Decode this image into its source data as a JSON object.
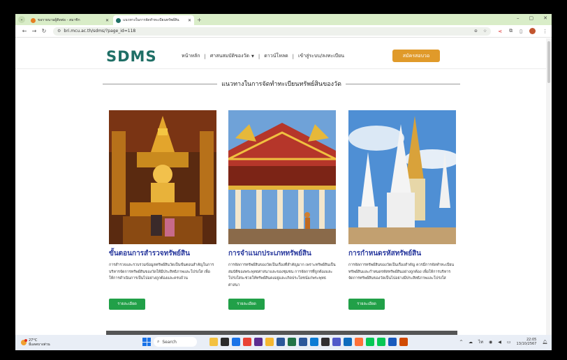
{
  "browser": {
    "tabs": [
      {
        "title": "ขอรายนามผู้ติดต่อ - สมาชิก",
        "active": false,
        "favicon_color": "#e67e22"
      },
      {
        "title": "แนวทางในการจัดทำทะเบียนทรัพย์สิน",
        "active": true,
        "favicon_color": "#1f6f66"
      }
    ],
    "new_tab_icon": "plus-icon",
    "address": "bri.mcu.ac.th/sdms/?page_id=118",
    "window_controls": [
      "–",
      "▢",
      "✕"
    ]
  },
  "site": {
    "logo": "SDMS",
    "menu": [
      {
        "label": "หน้าหลัก"
      },
      {
        "label": "ศาสนสมบัติของวัด",
        "dropdown": true
      },
      {
        "label": "ดาวน์โหลด"
      },
      {
        "label": "เข้าสู่ระบบ/ลงทะเบียน"
      }
    ],
    "register_button": "สมัครสอบวอ",
    "section_title": "แนวทางในการจัดทำทะเบียนทรัพย์สินของวัด",
    "cards": [
      {
        "title": "ขั้นตอนการสำรวจทรัพย์สิน",
        "desc": "การสำรวจและรวบรวมข้อมูลทรัพย์สินวัดเป็นขั้นตอนสำคัญในการบริหารจัดการทรัพย์สินของวัดให้มีประสิทธิภาพและโปร่งใส เพื่อให้การดำเนินการเป็นไปอย่างถูกต้องและครบถ้วน",
        "button": "รายละเอียด"
      },
      {
        "title": "การจำแนกประเภททรัพย์สิน",
        "desc": "การจัดการทรัพย์สินของวัดเป็นเรื่องที่สำคัญมาก เพราะทรัพย์สินเป็นสมบัติของพระพุทธศาสนาและของชุมชน การจัดการที่ถูกต้องและโปร่งใสจะช่วยให้ทรัพย์สินคงอยู่และเกิดประโยชน์แก่พระพุทธศาสนา",
        "button": "รายละเอียด"
      },
      {
        "title": "การกำหนดรหัสทรัพย์สิน",
        "desc": "การจัดการทรัพย์สินของวัดเป็นเรื่องสำคัญ ควรมีการจัดทำทะเบียนทรัพย์สินและกำหนดรหัสทรัพย์สินอย่างถูกต้อง เพื่อให้การบริหารจัดการทรัพย์สินของวัดเป็นไปอย่างมีประสิทธิภาพและโปร่งใส",
        "button": "รายละเอียด"
      }
    ]
  },
  "taskbar": {
    "weather_temp": "27°C",
    "weather_desc": "มีแดดบางส่วน",
    "search_label": "Search",
    "time": "22:05",
    "date": "13/10/2567",
    "apps": [
      {
        "name": "files-app-icon",
        "color": "#f3c141"
      },
      {
        "name": "media-app-icon",
        "color": "#2b2b2b"
      },
      {
        "name": "photos-app-icon",
        "color": "#1a73e8"
      },
      {
        "name": "chrome-app-icon",
        "color": "#e94235"
      },
      {
        "name": "store-app-icon",
        "color": "#5c2d91"
      },
      {
        "name": "explorer-app-icon",
        "color": "#f5b731"
      },
      {
        "name": "word-app-icon",
        "color": "#2b579a"
      },
      {
        "name": "excel-app-icon",
        "color": "#217346"
      },
      {
        "name": "powerpoint-app-icon",
        "color": "#2b579a"
      },
      {
        "name": "edge-app-icon",
        "color": "#0c7cd5"
      },
      {
        "name": "obs-app-icon",
        "color": "#302e31"
      },
      {
        "name": "teams-app-icon",
        "color": "#5059c9"
      },
      {
        "name": "outlook-app-icon",
        "color": "#0f6cbd"
      },
      {
        "name": "firefox-app-icon",
        "color": "#ff7139"
      },
      {
        "name": "line-app-icon",
        "color": "#06c755"
      },
      {
        "name": "line2-app-icon",
        "color": "#06c755"
      },
      {
        "name": "word2-app-icon",
        "color": "#185abd"
      },
      {
        "name": "network-app-icon",
        "color": "#d04a02"
      }
    ]
  }
}
